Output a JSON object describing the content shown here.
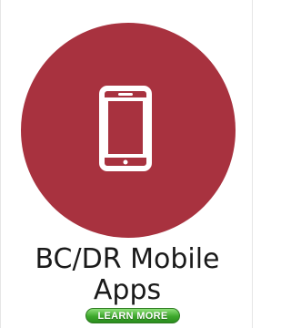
{
  "card": {
    "icon": "smartphone-icon",
    "title_line1": "BC/DR Mobile",
    "title_line2": "Apps",
    "button_label": "LEARN MORE"
  },
  "colors": {
    "circle": "#a8323f",
    "icon": "#ffffff",
    "button": "#3ea82c"
  }
}
